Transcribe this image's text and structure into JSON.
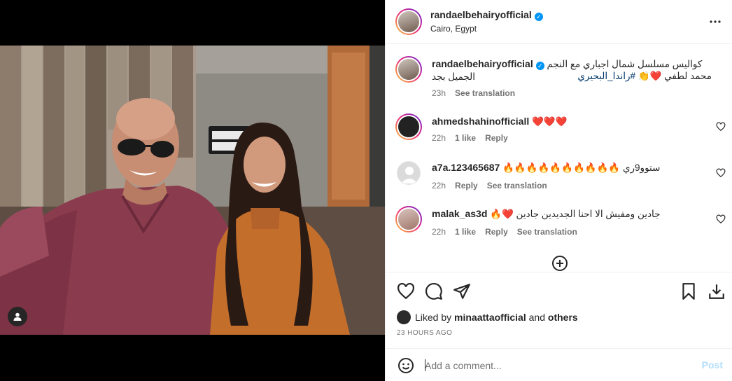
{
  "post": {
    "author": "randaelbehairyofficial",
    "location": "Cairo, Egypt",
    "caption_line1": "كواليس مسلسل شمال اجباري مع النجم الجميل بجد",
    "caption_line2": "محمد لطفي ❤️👏 ",
    "caption_hashtag": "#راندا_البحيري",
    "caption_time": "23h",
    "caption_translate": "See translation"
  },
  "comments": [
    {
      "user": "ahmedshahinofficiall",
      "text": "❤️❤️❤️",
      "time": "22h",
      "likes": "1 like",
      "reply": "Reply",
      "translate": ""
    },
    {
      "user": "a7a.123465687",
      "text": "🔥🔥🔥🔥🔥🔥🔥🔥🔥🔥 ستوو9ري",
      "time": "22h",
      "likes": "",
      "reply": "Reply",
      "translate": "See translation"
    },
    {
      "user": "malak_as3d",
      "text": "🔥❤️ جادين ومفيش الا احنا الجديدين جادين",
      "time": "22h",
      "likes": "1 like",
      "reply": "Reply",
      "translate": "See translation"
    }
  ],
  "likes_line": {
    "prefix": "Liked by",
    "user": "minaattaofficial",
    "and": "and",
    "others": "others"
  },
  "timestamp": "23 HOURS AGO",
  "add_comment": {
    "placeholder": "Add a comment...",
    "post_label": "Post"
  },
  "colors": {
    "verified": "#0095f6",
    "link": "#00376b",
    "post_disabled": "#b2dffc"
  }
}
